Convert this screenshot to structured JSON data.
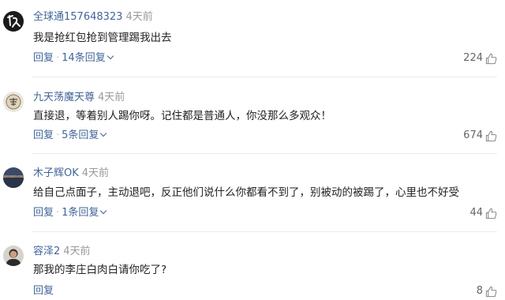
{
  "comments": [
    {
      "avatar_icon": "calligraphy-avatar",
      "username": "全球通157648323",
      "time": "4天前",
      "text": "我是抢红包抢到管理踢我出去",
      "reply_label": "回复",
      "replies_label": "14条回复",
      "likes": "224"
    },
    {
      "avatar_icon": "seal-avatar",
      "username": "九天荡魔天尊",
      "time": "4天前",
      "text": "直接退，等着别人踢你呀。记住都是普通人，你没那么多观众！",
      "reply_label": "回复",
      "replies_label": "5条回复",
      "likes": "674"
    },
    {
      "avatar_icon": "landscape-avatar",
      "username": "木子辉OK",
      "time": "4天前",
      "text": "给自己点面子，主动退吧，反正他们说什么你都看不到了，别被动的被踢了，心里也不好受",
      "reply_label": "回复",
      "replies_label": "1条回复",
      "likes": "44"
    },
    {
      "avatar_icon": "person-avatar",
      "username": "容泽2",
      "time": "4天前",
      "text": "那我的李庄白肉白请你吃了?",
      "reply_label": "回复",
      "likes": "8"
    }
  ],
  "colors": {
    "username": "#406599",
    "time": "#999999",
    "action": "#406599",
    "like_count": "#666666"
  },
  "icons": {
    "like": "thumbs-up-icon",
    "expand": "chevron-down-icon"
  }
}
